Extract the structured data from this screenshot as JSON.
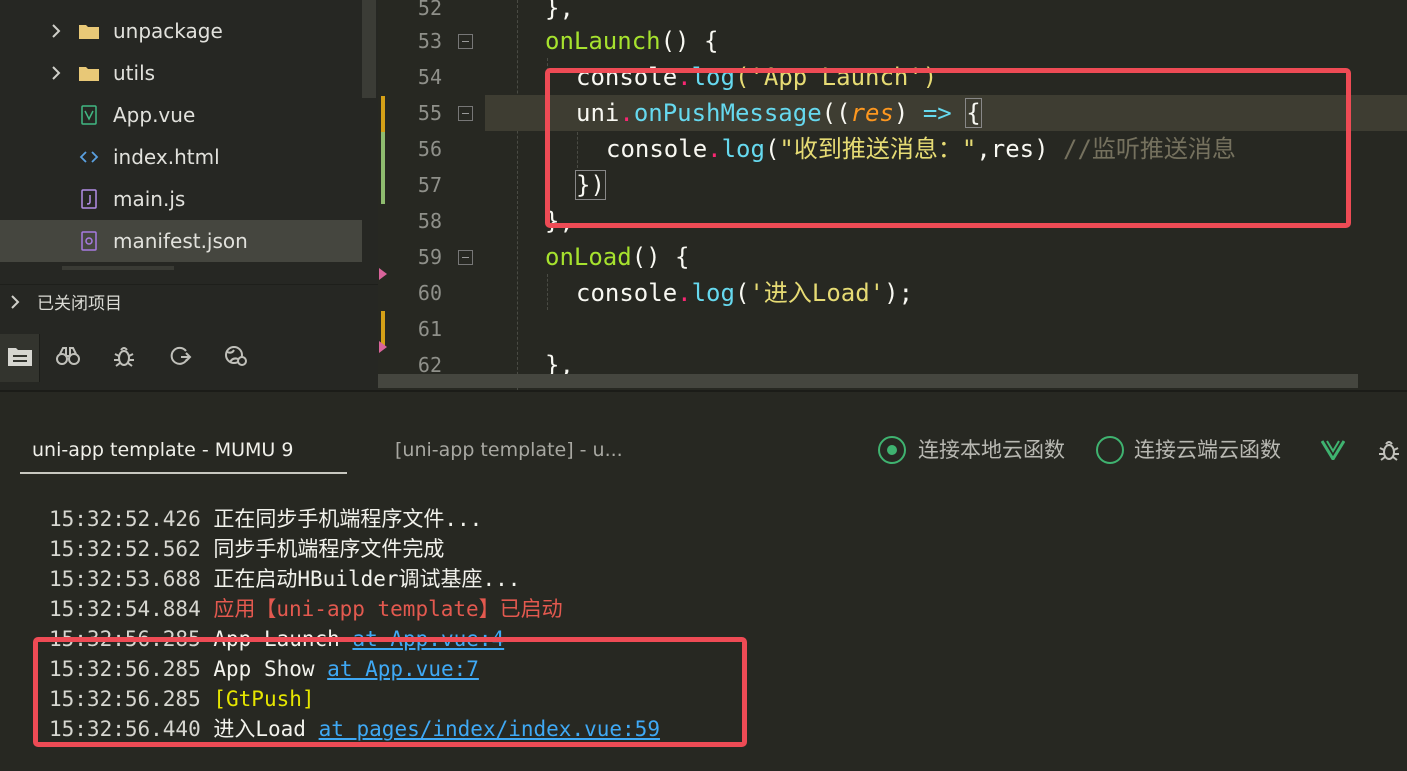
{
  "sidebar": {
    "items": [
      {
        "label": "unpackage",
        "type": "folder",
        "expandable": true
      },
      {
        "label": "utils",
        "type": "folder",
        "expandable": true
      },
      {
        "label": "App.vue",
        "type": "vue-file",
        "expandable": false
      },
      {
        "label": "index.html",
        "type": "html-file",
        "expandable": false
      },
      {
        "label": "main.js",
        "type": "js-file",
        "expandable": false
      },
      {
        "label": "manifest.json",
        "type": "json-file",
        "expandable": false,
        "selected": true
      }
    ],
    "closed_projects_label": "已关闭项目",
    "tabs": [
      "files-icon",
      "binoculars-icon",
      "bug-icon",
      "sync-icon",
      "globe-icon"
    ]
  },
  "editor": {
    "lines": [
      {
        "num": "52",
        "text": "},"
      },
      {
        "num": "53",
        "text": "onLaunch() {"
      },
      {
        "num": "54",
        "text": "console.log('App Launch')"
      },
      {
        "num": "55",
        "text": "uni.onPushMessage((res) => {"
      },
      {
        "num": "56",
        "text": "console.log(\"收到推送消息：\",res) //监听推送消息"
      },
      {
        "num": "57",
        "text": "})"
      },
      {
        "num": "58",
        "text": "},"
      },
      {
        "num": "59",
        "text": "onLoad() {"
      },
      {
        "num": "60",
        "text": "console.log('进入Load');"
      },
      {
        "num": "61",
        "text": ""
      },
      {
        "num": "62",
        "text": "},"
      }
    ],
    "tokens": {
      "onLaunch": "onLaunch",
      "parens_brace": "() {",
      "console": "console",
      "dot": ".",
      "log": "log",
      "app_launch_str": "('App Launch')",
      "uni": "uni",
      "onPushMessage": "onPushMessage",
      "open2": "((",
      "res": "res",
      "close_paren": ")",
      "arrow": "=>",
      "open_brace": "{",
      "push_str": "\"收到推送消息：\"",
      "res_arg": ",res) ",
      "comment": "//监听推送消息",
      "close_cb": "})",
      "close_obj": "},",
      "onLoad": "onLoad",
      "paren_open": "(",
      "load_str": "'进入Load'",
      "close_semi": ");"
    }
  },
  "console": {
    "tabs": {
      "active": "uni-app template - MUMU 9",
      "inactive": "[uni-app template] - u..."
    },
    "local_cloud_label": "连接本地云函数",
    "remote_cloud_label": "连接云端云函数",
    "logs": [
      {
        "time": "15:32:52.426",
        "msg": "正在同步手机端程序文件...",
        "link": ""
      },
      {
        "time": "15:32:52.562",
        "msg": "同步手机端程序文件完成",
        "link": ""
      },
      {
        "time": "15:32:53.688",
        "msg": "正在启动HBuilder调试基座...",
        "link": ""
      },
      {
        "time": "15:32:54.884",
        "msg": "应用【uni-app template】已启动",
        "link": ""
      },
      {
        "time": "15:32:56.285",
        "msg": "App Launch ",
        "link": "at App.vue:4"
      },
      {
        "time": "15:32:56.285",
        "msg": "App Show ",
        "link": "at App.vue:7"
      },
      {
        "time": "15:32:56.285",
        "msg": "[GtPush]",
        "link": ""
      },
      {
        "time": "15:32:56.440",
        "msg": "进入Load ",
        "link": "at pages/index/index.vue:59"
      }
    ]
  },
  "colors": {
    "accent_green": "#3fb370",
    "annotation_red": "#ee4b55",
    "link_blue": "#3fa9f5"
  }
}
